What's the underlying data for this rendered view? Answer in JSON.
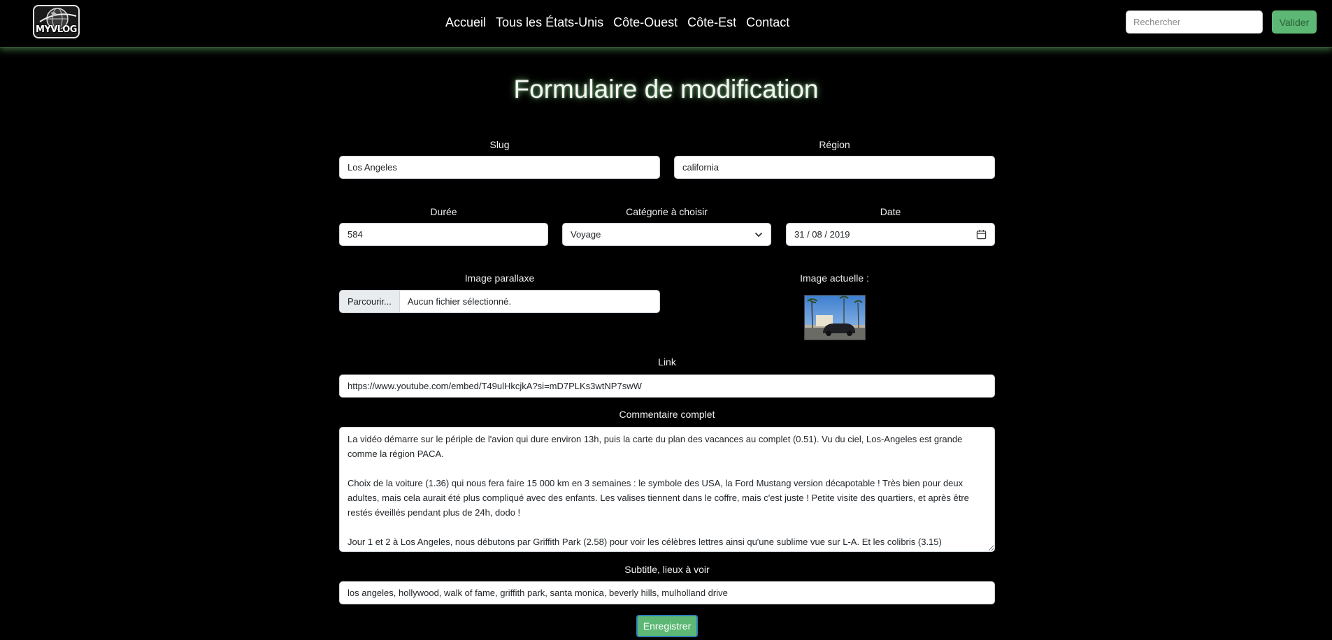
{
  "nav": {
    "logo_text": "MYVLOG",
    "links": [
      "Accueil",
      "Tous les États-Unis",
      "Côte-Ouest",
      "Côte-Est",
      "Contact"
    ],
    "search_placeholder": "Rechercher",
    "search_button": "Valider"
  },
  "title": "Formulaire de modification",
  "form": {
    "slug": {
      "label": "Slug",
      "value": "Los Angeles"
    },
    "region": {
      "label": "Région",
      "value": "california"
    },
    "duree": {
      "label": "Durée",
      "value": "584"
    },
    "categorie": {
      "label": "Catégorie à choisir",
      "value": "Voyage"
    },
    "date": {
      "label": "Date",
      "value": "31 / 08 / 2019"
    },
    "image_parallaxe": {
      "label": "Image parallaxe",
      "button": "Parcourir...",
      "file_status": "Aucun fichier sélectionné."
    },
    "image_actuelle": {
      "label": "Image actuelle :"
    },
    "link": {
      "label": "Link",
      "value": "https://www.youtube.com/embed/T49ulHkcjkA?si=mD7PLKs3wtNP7swW"
    },
    "commentaire": {
      "label": "Commentaire complet",
      "value": "La vidéo démarre sur le périple de l'avion qui dure environ 13h, puis la carte du plan des vacances au complet (0.51). Vu du ciel, Los-Angeles est grande comme la région PACA.\n\nChoix de la voiture (1.36) qui nous fera faire 15 000 km en 3 semaines : le symbole des USA, la Ford Mustang version décapotable ! Très bien pour deux adultes, mais cela aurait été plus compliqué avec des enfants. Les valises tiennent dans le coffre, mais c'est juste ! Petite visite des quartiers, et après être restés éveillés pendant plus de 24h, dodo !\n\nJour 1 et 2 à Los Angeles, nous débutons par Griffith Park (2.58) pour voir les célèbres lettres ainsi qu'une sublime vue sur L-A. Et les colibris (3.15)"
    },
    "subtitle": {
      "label": "Subtitle, lieux à voir",
      "value": "los angeles, hollywood, walk of fame, griffith park, santa monica, beverly hills, mulholland drive"
    },
    "submit": "Enregistrer"
  },
  "colors": {
    "accent_green": "#5cb874",
    "glow": "#96e696",
    "background": "#000000"
  }
}
